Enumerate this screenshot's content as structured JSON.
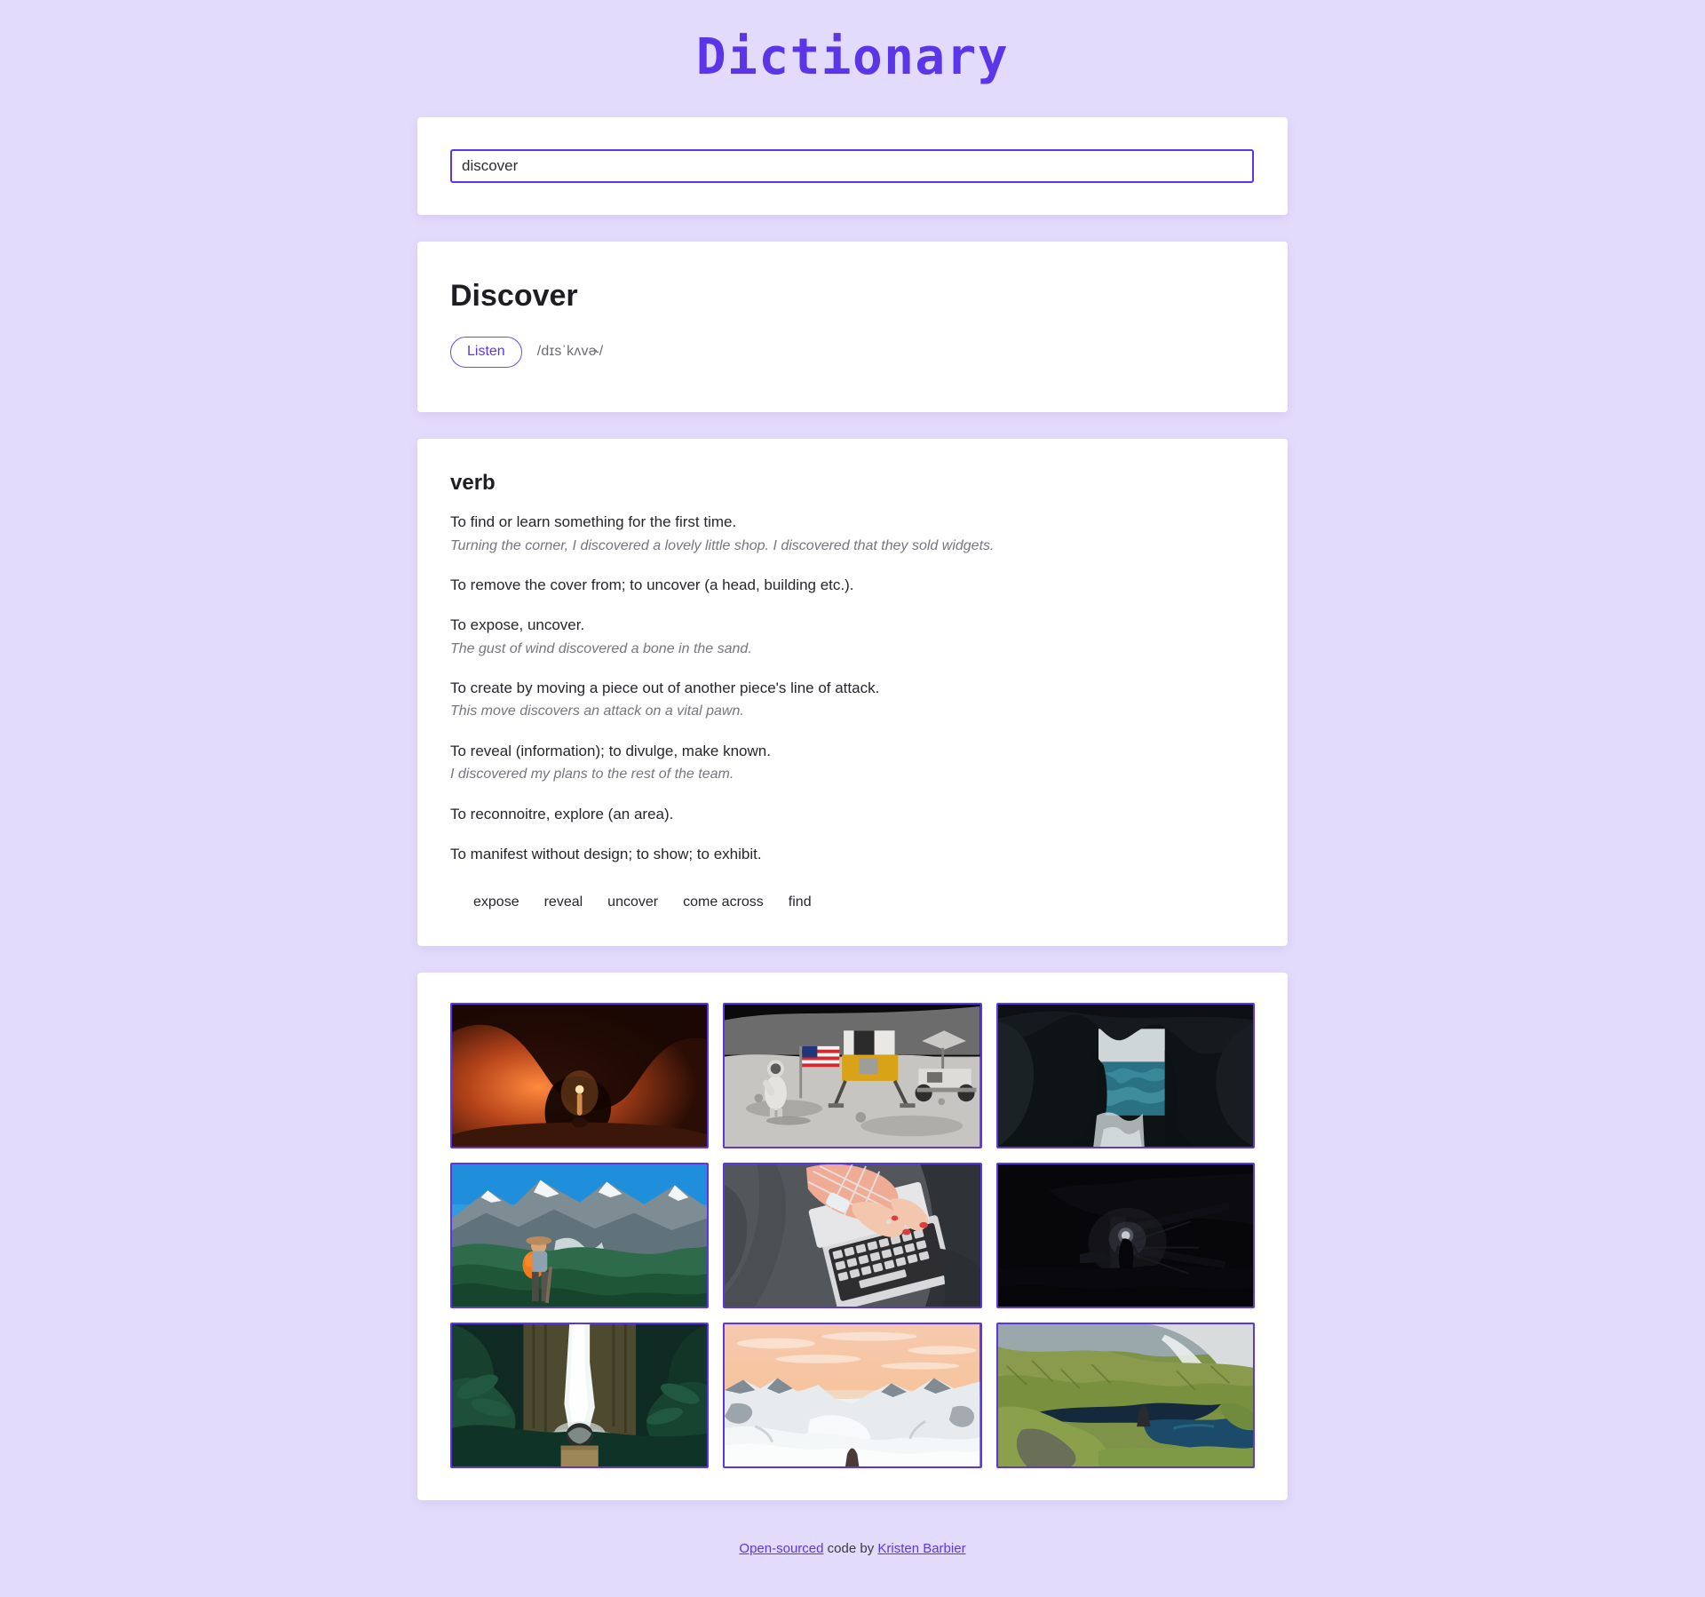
{
  "site": {
    "title": "Dictionary",
    "accent_color": "#5b36e8",
    "background_color": "#e3dbfb"
  },
  "search": {
    "value": "discover",
    "placeholder": "Search for a word"
  },
  "word": {
    "headword": "Discover",
    "listen_label": "Listen",
    "phonetic": "/dɪsˈkʌvɚ/"
  },
  "entry": {
    "part_of_speech": "verb",
    "definitions": [
      {
        "text": "To find or learn something for the first time.",
        "example": "Turning the corner, I discovered a lovely little shop. I discovered that they sold widgets."
      },
      {
        "text": "To remove the cover from; to uncover (a head, building etc.).",
        "example": ""
      },
      {
        "text": "To expose, uncover.",
        "example": "The gust of wind discovered a bone in the sand."
      },
      {
        "text": "To create by moving a piece out of another piece's line of attack.",
        "example": "This move discovers an attack on a vital pawn."
      },
      {
        "text": "To reveal (information); to divulge, make known.",
        "example": "I discovered my plans to the rest of the team."
      },
      {
        "text": "To reconnoitre, explore (an area).",
        "example": ""
      },
      {
        "text": "To manifest without design; to show; to exhibit.",
        "example": ""
      }
    ],
    "synonyms": [
      "expose",
      "reveal",
      "uncover",
      "come across",
      "find"
    ]
  },
  "images": [
    {
      "alt": "Person with torch inside a glowing orange cave"
    },
    {
      "alt": "Astronaut saluting American flag on the moon beside lunar module and rover"
    },
    {
      "alt": "Dark sea cave opening onto teal ocean"
    },
    {
      "alt": "Hiker with orange backpack facing snow-capped mountains"
    },
    {
      "alt": "Overhead view of hands typing on a laptop on a grey couch"
    },
    {
      "alt": "Very dark scene of a figure holding a lantern"
    },
    {
      "alt": "Waterfall in a green jungle with a person in the foreground"
    },
    {
      "alt": "Snowy mountain valley under a peach sunrise sky"
    },
    {
      "alt": "Green mountain valley with a dark blue alpine lake"
    }
  ],
  "footer": {
    "link_open_sourced": "Open-sourced",
    "middle_text": " code by ",
    "link_author": "Kristen Barbier"
  }
}
